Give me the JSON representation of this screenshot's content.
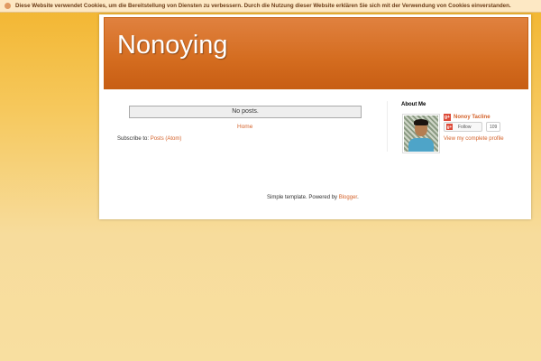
{
  "cookie_notice": {
    "text": "Diese Website verwendet Cookies, um die Bereitstellung von Diensten zu verbessern. Durch die Nutzung dieser Website erklären Sie sich mit der Verwendung von Cookies einverstanden."
  },
  "header": {
    "title": "Nonoying"
  },
  "main": {
    "no_posts": "No posts.",
    "home_link": "Home",
    "subscribe_label": "Subscribe to:",
    "subscribe_link": "Posts (Atom)"
  },
  "sidebar": {
    "about_heading": "About Me",
    "profile_name": "Nonoy Tacline",
    "gplus_icon_text": "g+",
    "follow_label": "Follow",
    "follow_count": "109",
    "view_profile": "View my complete profile"
  },
  "footer": {
    "prefix": "Simple template. Powered by ",
    "powered_link": "Blogger",
    "suffix": "."
  },
  "colors": {
    "accent": "#d4622a",
    "header": "#d46c1f",
    "background": "#f8dfa0"
  }
}
